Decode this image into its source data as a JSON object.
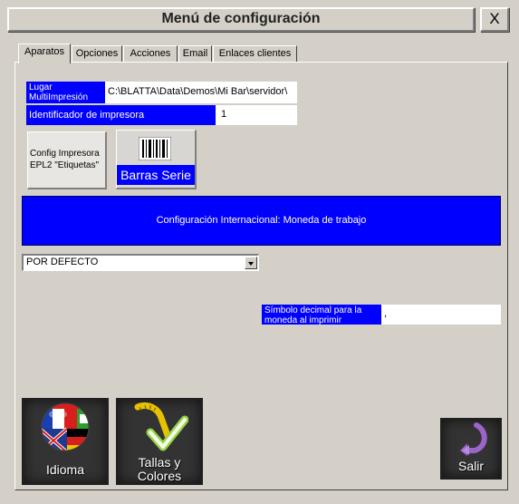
{
  "window": {
    "title": "Menú de configuración",
    "close_label": "X"
  },
  "tabs": [
    "Aparatos",
    "Opciones",
    "Acciones",
    "Email",
    "Enlaces clientes"
  ],
  "active_tab": "Aparatos",
  "printer_location": {
    "label": "Lugar MultiImpresión",
    "value": "C:\\BLATTA\\Data\\Demos\\Mi Bar\\servidor\\"
  },
  "printer_id": {
    "label": "Identificador de impresora",
    "value": "1"
  },
  "config_button": {
    "label": "Config Impresora EPL2 \"Etiquetas\""
  },
  "barcode_button": {
    "label": "Barras Serie",
    "icon": "barcode-icon"
  },
  "international_banner": {
    "label": "Configuración Internacional: Moneda de trabajo"
  },
  "currency_select": {
    "selected": "POR DEFECTO"
  },
  "decimal_symbol": {
    "label": "Símbolo decimal para la moneda al imprimir",
    "value": ","
  },
  "bottom_buttons": {
    "language": {
      "label": "Idioma",
      "icon": "flags-globe-icon"
    },
    "sizes": {
      "label": "Tallas y Colores",
      "icon": "measuring-tape-check-icon"
    },
    "exit": {
      "label": "Salir",
      "icon": "exit-arrow-icon"
    }
  },
  "colors": {
    "accent_blue": "#0000ff",
    "window_bg": "#d4d0c8"
  }
}
